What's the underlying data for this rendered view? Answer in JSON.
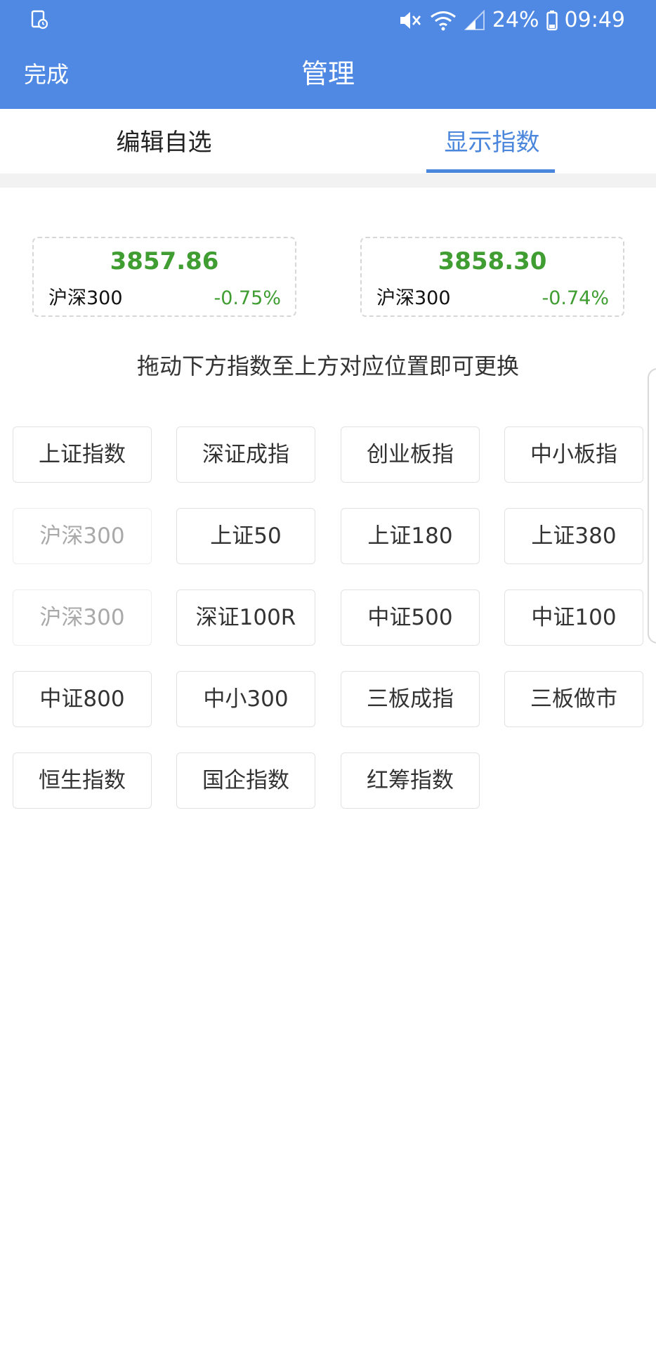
{
  "status_bar": {
    "battery": "24%",
    "time": "09:49",
    "left_icon": "notification-icon",
    "right_icons": [
      "mute-icon",
      "wifi-icon",
      "signal-icon",
      "battery-icon"
    ]
  },
  "nav": {
    "done_label": "完成",
    "title": "管理"
  },
  "tabs": [
    {
      "label": "编辑自选",
      "active": false
    },
    {
      "label": "显示指数",
      "active": true
    }
  ],
  "cards": [
    {
      "value": "3857.86",
      "name": "沪深300",
      "change": "-0.75%"
    },
    {
      "value": "3858.30",
      "name": "沪深300",
      "change": "-0.74%"
    }
  ],
  "hint": "拖动下方指数至上方对应位置即可更换",
  "indices": [
    {
      "label": "上证指数",
      "disabled": false
    },
    {
      "label": "深证成指",
      "disabled": false
    },
    {
      "label": "创业板指",
      "disabled": false
    },
    {
      "label": "中小板指",
      "disabled": false
    },
    {
      "label": "沪深300",
      "disabled": true
    },
    {
      "label": "上证50",
      "disabled": false
    },
    {
      "label": "上证180",
      "disabled": false
    },
    {
      "label": "上证380",
      "disabled": false
    },
    {
      "label": "沪深300",
      "disabled": true
    },
    {
      "label": "深证100R",
      "disabled": false
    },
    {
      "label": "中证500",
      "disabled": false
    },
    {
      "label": "中证100",
      "disabled": false
    },
    {
      "label": "中证800",
      "disabled": false
    },
    {
      "label": "中小300",
      "disabled": false
    },
    {
      "label": "三板成指",
      "disabled": false
    },
    {
      "label": "三板做市",
      "disabled": false
    },
    {
      "label": "恒生指数",
      "disabled": false
    },
    {
      "label": "国企指数",
      "disabled": false
    },
    {
      "label": "红筹指数",
      "disabled": false
    }
  ],
  "colors": {
    "header": "#5089e4",
    "tab_active": "#4a86dc",
    "price_green": "#3f9d32",
    "disabled_text": "#a9a9a9"
  }
}
